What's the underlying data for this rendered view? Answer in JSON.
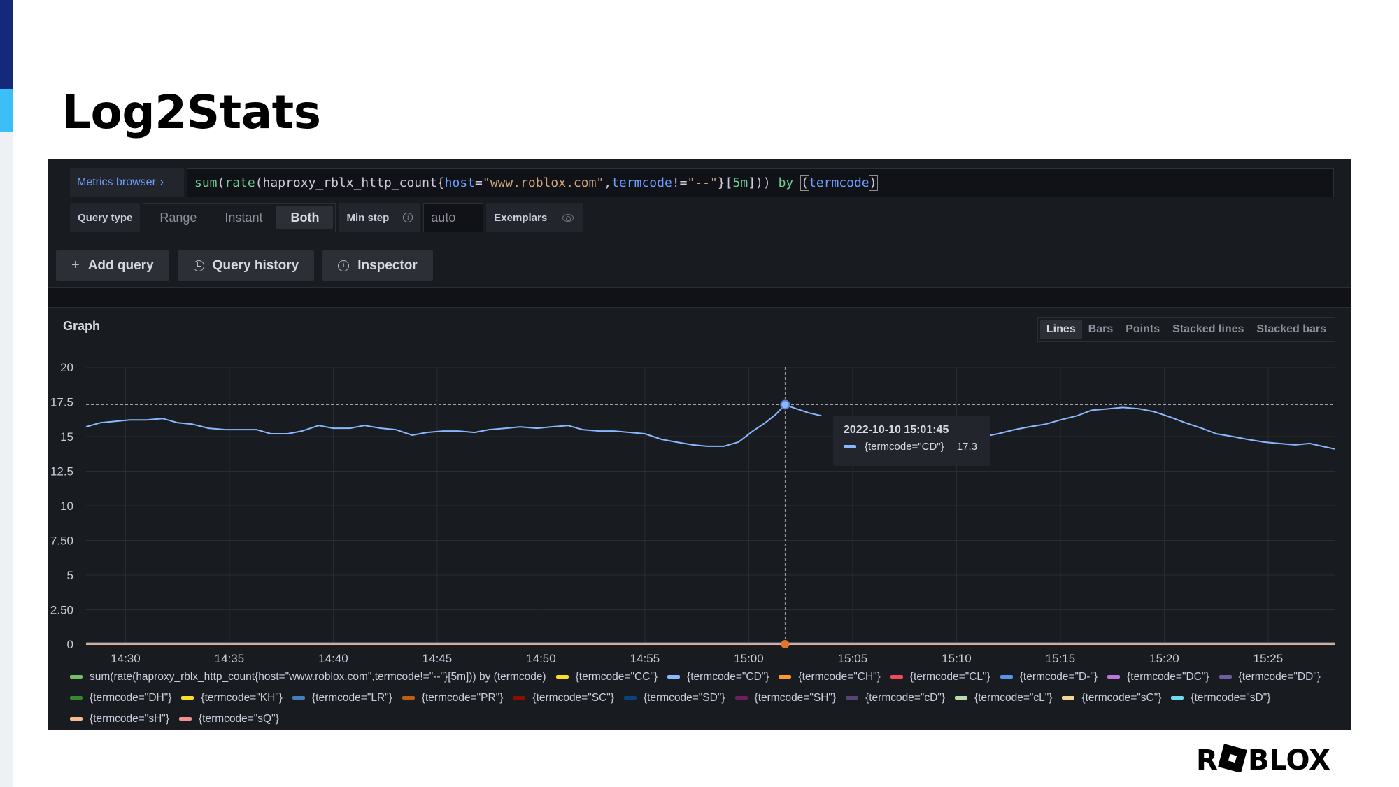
{
  "slide": {
    "title": "Log2Stats"
  },
  "query": {
    "metrics_browser_label": "Metrics browser",
    "expression": "sum(rate(haproxy_rblx_http_count{host=\"www.roblox.com\",termcode!=\"--\"}[5m])) by (termcode)",
    "tokens": [
      {
        "t": "sum",
        "c": "fn"
      },
      {
        "t": "(",
        "c": "num"
      },
      {
        "t": "rate",
        "c": "fn"
      },
      {
        "t": "(haproxy_rblx_http_count{",
        "c": "num"
      },
      {
        "t": "host",
        "c": "lbl"
      },
      {
        "t": "=",
        "c": "num"
      },
      {
        "t": "\"www.roblox.com\"",
        "c": "str"
      },
      {
        "t": ",",
        "c": "num"
      },
      {
        "t": "termcode",
        "c": "lbl"
      },
      {
        "t": "!=",
        "c": "num"
      },
      {
        "t": "\"--\"",
        "c": "str"
      },
      {
        "t": "}[",
        "c": "num"
      },
      {
        "t": "5m",
        "c": "fn"
      },
      {
        "t": "])) ",
        "c": "num"
      },
      {
        "t": "by",
        "c": "kw"
      },
      {
        "t": " ",
        "c": "num"
      },
      {
        "t": "(",
        "c": "bracket"
      },
      {
        "t": "termcode",
        "c": "lbl"
      },
      {
        "t": ")",
        "c": "bracket"
      }
    ]
  },
  "options": {
    "query_type_label": "Query type",
    "query_types": [
      "Range",
      "Instant",
      "Both"
    ],
    "selected_query_type": "Both",
    "min_step_label": "Min step",
    "min_step_placeholder": "auto",
    "exemplars_label": "Exemplars"
  },
  "buttons": {
    "add_query": "Add query",
    "query_history": "Query history",
    "inspector": "Inspector"
  },
  "graph": {
    "title": "Graph",
    "view_modes": [
      "Lines",
      "Bars",
      "Points",
      "Stacked lines",
      "Stacked bars"
    ],
    "selected_view_mode": "Lines"
  },
  "tooltip": {
    "time": "2022-10-10 15:01:45",
    "series": "{termcode=\"CD\"}",
    "value": "17.3",
    "color": "#8ab8ff"
  },
  "chart_data": {
    "type": "line",
    "title": "Graph",
    "xlabel": "",
    "ylabel": "",
    "x_ticks": [
      "14:30",
      "14:35",
      "14:40",
      "14:45",
      "14:50",
      "14:55",
      "15:00",
      "15:05",
      "15:10",
      "15:15",
      "15:20",
      "15:25"
    ],
    "y_ticks": [
      "0",
      "2.50",
      "5",
      "7.50",
      "10",
      "12.5",
      "15",
      "17.5",
      "20"
    ],
    "ylim": [
      0,
      20
    ],
    "xlim_minutes_after_1400": [
      28.1,
      88.2
    ],
    "grid": true,
    "legend_position": "bottom",
    "threshold_line": 17.3,
    "hover_x_minutes_after_1400": 61.75,
    "series": [
      {
        "name": "{termcode=\"CD\"}",
        "color": "#8ab8ff",
        "x": [
          28.1,
          28.8,
          29.5,
          30.2,
          31.0,
          31.8,
          32.5,
          33.2,
          34.0,
          34.8,
          35.5,
          36.3,
          37.0,
          37.8,
          38.5,
          39.3,
          40.0,
          40.8,
          41.5,
          42.3,
          43.0,
          43.8,
          44.5,
          45.3,
          46.0,
          46.8,
          47.5,
          48.3,
          49.0,
          49.8,
          50.5,
          51.3,
          52.0,
          52.8,
          53.5,
          54.3,
          55.0,
          55.8,
          56.5,
          57.3,
          58.0,
          58.8,
          59.5,
          60.2,
          60.8,
          61.3,
          61.75,
          62.3,
          62.9,
          63.5,
          null,
          67.5,
          68.3,
          69.0,
          69.8,
          70.5,
          71.3,
          72.0,
          72.8,
          73.5,
          74.3,
          75.0,
          75.8,
          76.5,
          77.3,
          78.0,
          78.8,
          79.5,
          80.3,
          81.0,
          81.8,
          82.5,
          83.3,
          84.0,
          84.8,
          85.5,
          86.3,
          87.0,
          87.6,
          88.2
        ],
        "values": [
          15.7,
          16.0,
          16.1,
          16.2,
          16.2,
          16.3,
          16.0,
          15.9,
          15.6,
          15.5,
          15.5,
          15.5,
          15.2,
          15.2,
          15.4,
          15.8,
          15.6,
          15.6,
          15.8,
          15.6,
          15.5,
          15.1,
          15.3,
          15.4,
          15.4,
          15.3,
          15.5,
          15.6,
          15.7,
          15.6,
          15.7,
          15.8,
          15.5,
          15.4,
          15.4,
          15.3,
          15.2,
          14.8,
          14.6,
          14.4,
          14.3,
          14.3,
          14.6,
          15.4,
          16.0,
          16.6,
          17.3,
          17.0,
          16.7,
          16.5,
          null,
          13.8,
          14.0,
          14.1,
          14.4,
          14.8,
          15.0,
          15.2,
          15.5,
          15.7,
          15.9,
          16.2,
          16.5,
          16.9,
          17.0,
          17.1,
          17.0,
          16.8,
          16.4,
          16.0,
          15.6,
          15.2,
          15.0,
          14.8,
          14.6,
          14.5,
          14.4,
          14.5,
          14.3,
          14.1
        ]
      },
      {
        "name": "sum(rate(haproxy_rblx_http_count{host=\"www.roblox.com\",termcode!=\"--\"}[5m])) by (termcode)",
        "color": "#73bf69",
        "values_approx": 0
      },
      {
        "name": "{termcode=\"CC\"}",
        "color": "#fade2a",
        "values_approx": 0
      },
      {
        "name": "{termcode=\"CH\"}",
        "color": "#ff9830",
        "values_approx": 0.1
      },
      {
        "name": "{termcode=\"CL\"}",
        "color": "#f2495c",
        "values_approx": 0.1
      },
      {
        "name": "{termcode=\"D-\"}",
        "color": "#5794f2",
        "values_approx": 0
      },
      {
        "name": "{termcode=\"DC\"}",
        "color": "#b877d9",
        "values_approx": 0
      },
      {
        "name": "{termcode=\"DD\"}",
        "color": "#705da0",
        "values_approx": 0
      },
      {
        "name": "{termcode=\"DH\"}",
        "color": "#37872d",
        "values_approx": 0
      },
      {
        "name": "{termcode=\"KH\"}",
        "color": "#fade2a",
        "values_approx": 0
      },
      {
        "name": "{termcode=\"LR\"}",
        "color": "#447ebc",
        "values_approx": 0
      },
      {
        "name": "{termcode=\"PR\"}",
        "color": "#c15c17",
        "values_approx": 0
      },
      {
        "name": "{termcode=\"SC\"}",
        "color": "#890f02",
        "values_approx": 0
      },
      {
        "name": "{termcode=\"SD\"}",
        "color": "#0a437c",
        "values_approx": 0
      },
      {
        "name": "{termcode=\"SH\"}",
        "color": "#6d1f62",
        "values_approx": 0
      },
      {
        "name": "{termcode=\"cD\"}",
        "color": "#584477",
        "values_approx": 0
      },
      {
        "name": "{termcode=\"cL\"}",
        "color": "#b7dbab",
        "values_approx": 0
      },
      {
        "name": "{termcode=\"sC\"}",
        "color": "#f4d598",
        "values_approx": 0
      },
      {
        "name": "{termcode=\"sD\"}",
        "color": "#70dbed",
        "values_approx": 0
      },
      {
        "name": "{termcode=\"sH\"}",
        "color": "#f9ba8f",
        "values_approx": 0
      },
      {
        "name": "{termcode=\"sQ\"}",
        "color": "#f29191",
        "values_approx": 0
      }
    ]
  },
  "legend": [
    {
      "label": "sum(rate(haproxy_rblx_http_count{host=\"www.roblox.com\",termcode!=\"--\"}[5m])) by (termcode)",
      "color": "#73bf69"
    },
    {
      "label": "{termcode=\"CC\"}",
      "color": "#fade2a"
    },
    {
      "label": "{termcode=\"CD\"}",
      "color": "#8ab8ff"
    },
    {
      "label": "{termcode=\"CH\"}",
      "color": "#ff9830"
    },
    {
      "label": "{termcode=\"CL\"}",
      "color": "#f2495c"
    },
    {
      "label": "{termcode=\"D-\"}",
      "color": "#5794f2"
    },
    {
      "label": "{termcode=\"DC\"}",
      "color": "#b877d9"
    },
    {
      "label": "{termcode=\"DD\"}",
      "color": "#705da0"
    },
    {
      "label": "{termcode=\"DH\"}",
      "color": "#37872d"
    },
    {
      "label": "{termcode=\"KH\"}",
      "color": "#fade2a"
    },
    {
      "label": "{termcode=\"LR\"}",
      "color": "#447ebc"
    },
    {
      "label": "{termcode=\"PR\"}",
      "color": "#c15c17"
    },
    {
      "label": "{termcode=\"SC\"}",
      "color": "#890f02"
    },
    {
      "label": "{termcode=\"SD\"}",
      "color": "#0a437c"
    },
    {
      "label": "{termcode=\"SH\"}",
      "color": "#6d1f62"
    },
    {
      "label": "{termcode=\"cD\"}",
      "color": "#584477"
    },
    {
      "label": "{termcode=\"cL\"}",
      "color": "#b7dbab"
    },
    {
      "label": "{termcode=\"sC\"}",
      "color": "#f4d598"
    },
    {
      "label": "{termcode=\"sD\"}",
      "color": "#70dbed"
    },
    {
      "label": "{termcode=\"sH\"}",
      "color": "#f9ba8f"
    },
    {
      "label": "{termcode=\"sQ\"}",
      "color": "#f29191"
    }
  ],
  "brand": {
    "logo_text": "ROBLOX"
  }
}
